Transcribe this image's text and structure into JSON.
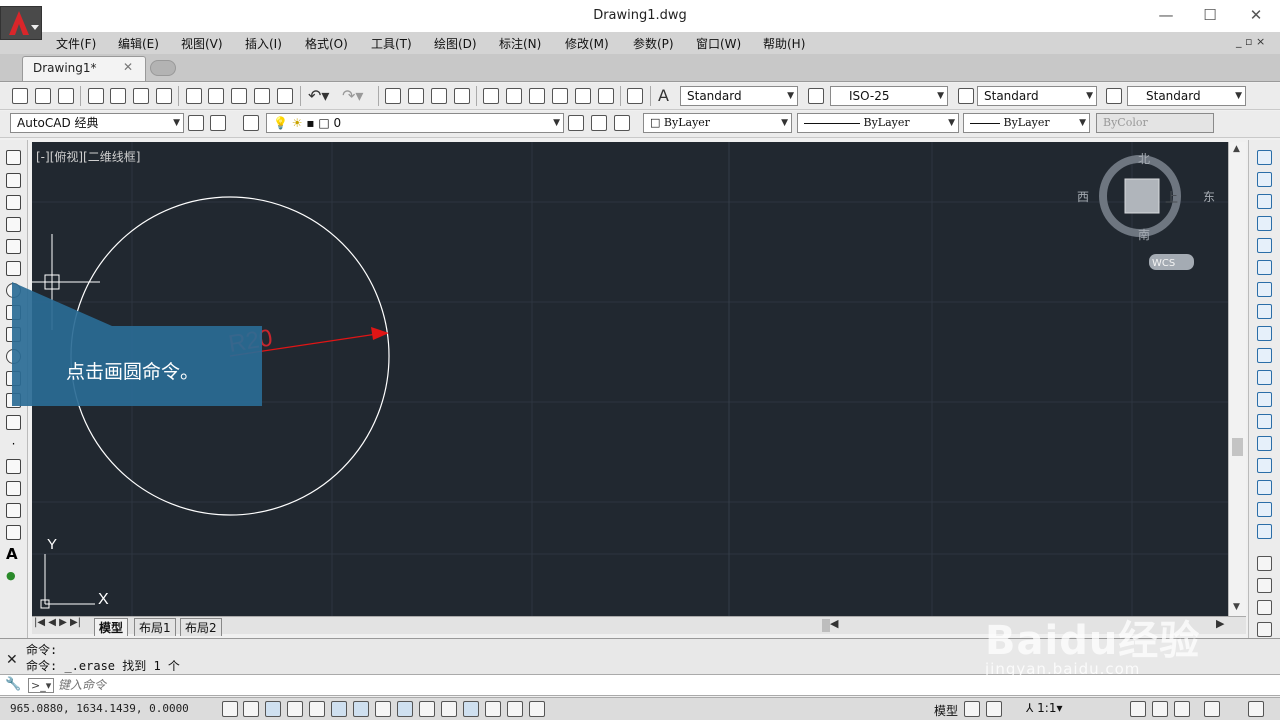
{
  "window": {
    "title": "Drawing1.dwg",
    "minimize": "—",
    "maximize": "☐",
    "close": "✕"
  },
  "menu": [
    "文件(F)",
    "编辑(E)",
    "视图(V)",
    "插入(I)",
    "格式(O)",
    "工具(T)",
    "绘图(D)",
    "标注(N)",
    "修改(M)",
    "参数(P)",
    "窗口(W)",
    "帮助(H)"
  ],
  "document_tab": {
    "label": "Drawing1*",
    "close": "✕"
  },
  "styles_toolbar": {
    "text_style": "Standard",
    "dim_style": "ISO-25",
    "table_style": "Standard",
    "mleader_style": "Standard"
  },
  "workspace": "AutoCAD 经典",
  "layer": {
    "current": "0"
  },
  "properties": {
    "color": "ByLayer",
    "linetype": "ByLayer",
    "lineweight": "ByLayer",
    "plotstyle": "ByColor"
  },
  "viewport_label": "[-][俯视][二维线框]",
  "viewcube": {
    "north": "北",
    "south": "南",
    "east": "东",
    "west": "西",
    "center": "上",
    "wcs": "WCS"
  },
  "drawing": {
    "dimension_text": "R20",
    "ucs_x": "X",
    "ucs_y": "Y"
  },
  "callout": {
    "text": "点击画圆命令。"
  },
  "layout_tabs": [
    "模型",
    "布局1",
    "布局2"
  ],
  "command_history": [
    "命令:",
    "命令: _.erase 找到 1 个"
  ],
  "command_placeholder": "键入命令",
  "status": {
    "coordinates": "965.0880,  1634.1439, 0.0000",
    "model_label": "模型",
    "scale": "1:1"
  },
  "watermark": {
    "logo": "Baidu经验",
    "url": "jingyan.baidu.com"
  },
  "colors": {
    "canvas": "#212830",
    "callout": "#2a6b95",
    "dimension": "#e01515"
  }
}
